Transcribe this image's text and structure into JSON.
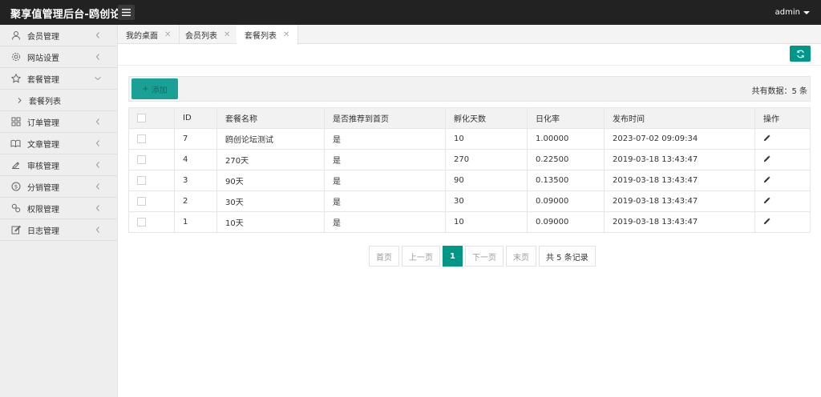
{
  "header": {
    "title": "聚享值管理后台-鸥创论",
    "user": "admin"
  },
  "sidebar": {
    "items": [
      {
        "label": "会员管理",
        "icon": "user-icon",
        "expanded": false
      },
      {
        "label": "网站设置",
        "icon": "gear-icon",
        "expanded": false
      },
      {
        "label": "套餐管理",
        "icon": "star-icon",
        "expanded": true
      },
      {
        "label": "订单管理",
        "icon": "grid-icon",
        "expanded": false
      },
      {
        "label": "文章管理",
        "icon": "book-icon",
        "expanded": false
      },
      {
        "label": "审核管理",
        "icon": "stamp-icon",
        "expanded": false
      },
      {
        "label": "分销管理",
        "icon": "dollar-icon",
        "expanded": false
      },
      {
        "label": "权限管理",
        "icon": "link-icon",
        "expanded": false
      },
      {
        "label": "日志管理",
        "icon": "edit-icon",
        "expanded": false
      }
    ],
    "subitem": {
      "label": "套餐列表"
    }
  },
  "tabs": [
    {
      "label": "我的桌面",
      "active": false
    },
    {
      "label": "会员列表",
      "active": false
    },
    {
      "label": "套餐列表",
      "active": true
    }
  ],
  "toolbar": {
    "add_label": "添加",
    "count_label": "共有数据：5 条"
  },
  "table": {
    "columns": [
      "ID",
      "套餐名称",
      "是否推荐到首页",
      "孵化天数",
      "日化率",
      "发布时间",
      "操作"
    ],
    "rows": [
      {
        "id": "7",
        "name": "鸥创论坛测试",
        "recommend": "是",
        "days": "10",
        "rate": "1.00000",
        "time": "2023-07-02 09:09:34"
      },
      {
        "id": "4",
        "name": "270天",
        "recommend": "是",
        "days": "270",
        "rate": "0.22500",
        "time": "2019-03-18 13:43:47"
      },
      {
        "id": "3",
        "name": "90天",
        "recommend": "是",
        "days": "90",
        "rate": "0.13500",
        "time": "2019-03-18 13:43:47"
      },
      {
        "id": "2",
        "name": "30天",
        "recommend": "是",
        "days": "30",
        "rate": "0.09000",
        "time": "2019-03-18 13:43:47"
      },
      {
        "id": "1",
        "name": "10天",
        "recommend": "是",
        "days": "10",
        "rate": "0.09000",
        "time": "2019-03-18 13:43:47"
      }
    ]
  },
  "pagination": {
    "first": "首页",
    "prev": "上一页",
    "current": "1",
    "next": "下一页",
    "last": "末页",
    "total": "共 5 条记录"
  },
  "colors": {
    "accent": "#009688",
    "topbar": "#222222",
    "sidebar": "#eeeeee"
  }
}
